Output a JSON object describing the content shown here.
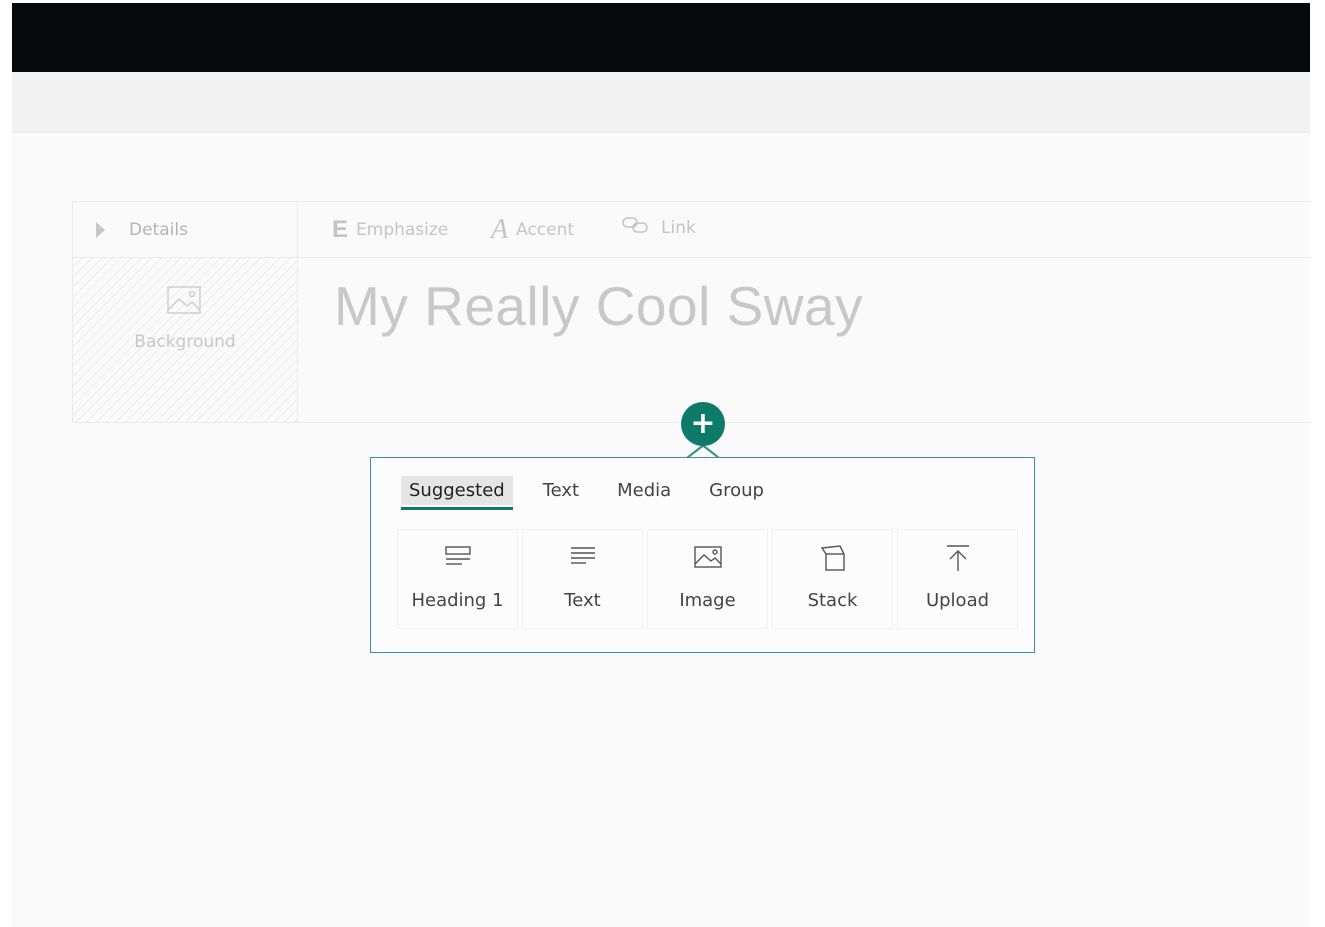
{
  "card": {
    "details_label": "Details",
    "background_label": "Background",
    "format": {
      "emphasize_label": "Emphasize",
      "accent_label": "Accent",
      "link_label": "Link"
    },
    "title": "My Really Cool Sway"
  },
  "insert": {
    "plus_icon": "plus-icon",
    "tabs": [
      {
        "label": "Suggested",
        "active": true
      },
      {
        "label": "Text",
        "active": false
      },
      {
        "label": "Media",
        "active": false
      },
      {
        "label": "Group",
        "active": false
      }
    ],
    "tiles": [
      {
        "label": "Heading 1",
        "icon": "heading-icon"
      },
      {
        "label": "Text",
        "icon": "text-lines-icon"
      },
      {
        "label": "Image",
        "icon": "image-icon"
      },
      {
        "label": "Stack",
        "icon": "stack-icon"
      },
      {
        "label": "Upload",
        "icon": "upload-icon"
      }
    ]
  },
  "colors": {
    "accent": "#0d7a6a",
    "popup_border": "#3b9484",
    "titlebar": "#08090a"
  }
}
